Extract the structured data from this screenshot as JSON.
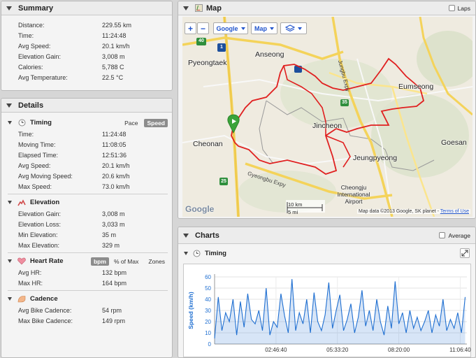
{
  "summary": {
    "title": "Summary",
    "rows": [
      {
        "label": "Distance:",
        "value": "229.55 km"
      },
      {
        "label": "Time:",
        "value": "11:24:48"
      },
      {
        "label": "Avg Speed:",
        "value": "20.1 km/h"
      },
      {
        "label": "Elevation Gain:",
        "value": "3,008 m"
      },
      {
        "label": "Calories:",
        "value": "5,788 C"
      },
      {
        "label": "Avg Temperature:",
        "value": "22.5 °C"
      }
    ]
  },
  "details": {
    "title": "Details",
    "timing": {
      "title": "Timing",
      "toggle_pace": "Pace",
      "toggle_speed": "Speed",
      "rows": [
        {
          "label": "Time:",
          "value": "11:24:48"
        },
        {
          "label": "Moving Time:",
          "value": "11:08:05"
        },
        {
          "label": "Elapsed Time:",
          "value": "12:51:36"
        },
        {
          "label": "Avg Speed:",
          "value": "20.1 km/h"
        },
        {
          "label": "Avg Moving Speed:",
          "value": "20.6 km/h"
        },
        {
          "label": "Max Speed:",
          "value": "73.0 km/h"
        }
      ]
    },
    "elevation": {
      "title": "Elevation",
      "rows": [
        {
          "label": "Elevation Gain:",
          "value": "3,008 m"
        },
        {
          "label": "Elevation Loss:",
          "value": "3,033 m"
        },
        {
          "label": "Min Elevation:",
          "value": "35 m"
        },
        {
          "label": "Max Elevation:",
          "value": "329 m"
        }
      ]
    },
    "heart_rate": {
      "title": "Heart Rate",
      "toggle_bpm": "bpm",
      "toggle_pct": "% of Max",
      "toggle_zones": "Zones",
      "rows": [
        {
          "label": "Avg HR:",
          "value": "132 bpm"
        },
        {
          "label": "Max HR:",
          "value": "164 bpm"
        }
      ]
    },
    "cadence": {
      "title": "Cadence",
      "rows": [
        {
          "label": "Avg Bike Cadence:",
          "value": "54 rpm"
        },
        {
          "label": "Max Bike Cadence:",
          "value": "149 rpm"
        }
      ]
    }
  },
  "map": {
    "title": "Map",
    "laps_label": "Laps",
    "zoom_in": "+",
    "zoom_out": "−",
    "provider_label": "Google",
    "type_label": "Map",
    "cities": [
      "Anseong",
      "Pyeongtaek",
      "Eumseong",
      "Jincheon",
      "Cheonan",
      "Goesan",
      "Jeungpyeong",
      "Cheongju International Airport"
    ],
    "road_labels": [
      "Gyeongbu Expy",
      "Jungbu Expy"
    ],
    "highway_shields": [
      "40",
      "1",
      "35",
      "25"
    ],
    "scale_km": "10 km",
    "scale_mi": "5 mi",
    "google_logo": "Google",
    "attribution": "Map data ©2013 Google, SK planet",
    "terms": "Terms of Use"
  },
  "charts": {
    "title": "Charts",
    "average_label": "Average",
    "timing_title": "Timing"
  },
  "chart_data": {
    "type": "area",
    "ylabel": "Speed (km/h)",
    "ylim": [
      0,
      60
    ],
    "yticks": [
      0,
      10,
      20,
      30,
      40,
      50,
      60
    ],
    "xlim": [
      "00:00:00",
      "11:24:48"
    ],
    "xticks": [
      "02:46:40",
      "05:33:20",
      "08:20:00",
      "11:06:40"
    ],
    "color": "#1f6fd1",
    "series": [
      {
        "x": [
          "00:00:00",
          "00:10:00",
          "00:20:00",
          "00:30:00",
          "00:40:00",
          "00:50:00",
          "01:00:00",
          "01:10:00",
          "01:20:00",
          "01:30:00",
          "01:40:00",
          "01:50:00",
          "02:00:00",
          "02:10:00",
          "02:20:00",
          "02:30:00",
          "02:40:00",
          "02:50:00",
          "03:00:00",
          "03:10:00",
          "03:20:00",
          "03:30:00",
          "03:40:00",
          "03:50:00",
          "04:00:00",
          "04:10:00",
          "04:20:00",
          "04:30:00",
          "04:40:00",
          "04:50:00",
          "05:00:00",
          "05:10:00",
          "05:20:00",
          "05:30:00",
          "05:40:00",
          "05:50:00",
          "06:00:00",
          "06:10:00",
          "06:20:00",
          "06:30:00",
          "06:40:00",
          "06:50:00",
          "07:00:00",
          "07:10:00",
          "07:20:00",
          "07:30:00",
          "07:40:00",
          "07:50:00",
          "08:00:00",
          "08:10:00",
          "08:20:00",
          "08:30:00",
          "08:40:00",
          "08:50:00",
          "09:00:00",
          "09:10:00",
          "09:20:00",
          "09:30:00",
          "09:40:00",
          "09:50:00",
          "10:00:00",
          "10:10:00",
          "10:20:00",
          "10:30:00",
          "10:40:00",
          "10:50:00",
          "11:00:00",
          "11:10:00",
          "11:20:00"
        ],
        "y": [
          5,
          42,
          12,
          28,
          20,
          40,
          8,
          38,
          15,
          45,
          22,
          18,
          30,
          12,
          50,
          8,
          20,
          15,
          45,
          25,
          10,
          58,
          12,
          28,
          18,
          40,
          10,
          46,
          20,
          12,
          26,
          55,
          14,
          30,
          44,
          12,
          22,
          36,
          10,
          24,
          48,
          16,
          30,
          12,
          40,
          20,
          8,
          34,
          14,
          56,
          18,
          28,
          10,
          30,
          14,
          24,
          12,
          20,
          30,
          10,
          26,
          16,
          40,
          12,
          22,
          14,
          28,
          10,
          42
        ]
      }
    ]
  }
}
